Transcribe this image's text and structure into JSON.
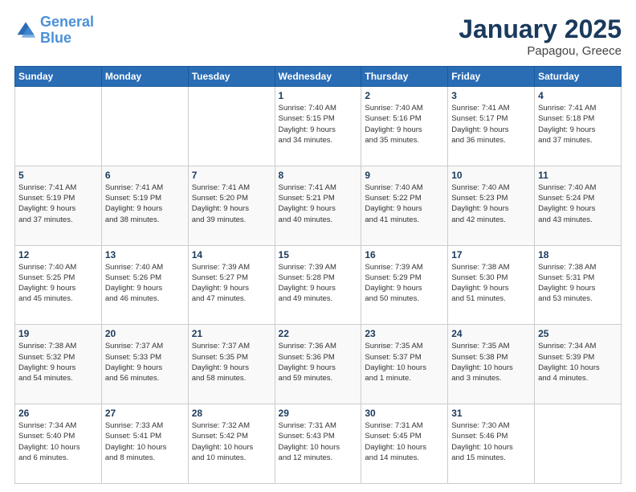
{
  "header": {
    "logo_line1": "General",
    "logo_line2": "Blue",
    "month_title": "January 2025",
    "location": "Papagou, Greece"
  },
  "days_of_week": [
    "Sunday",
    "Monday",
    "Tuesday",
    "Wednesday",
    "Thursday",
    "Friday",
    "Saturday"
  ],
  "weeks": [
    {
      "shaded": false,
      "days": [
        {
          "num": "",
          "info": ""
        },
        {
          "num": "",
          "info": ""
        },
        {
          "num": "",
          "info": ""
        },
        {
          "num": "1",
          "info": "Sunrise: 7:40 AM\nSunset: 5:15 PM\nDaylight: 9 hours\nand 34 minutes."
        },
        {
          "num": "2",
          "info": "Sunrise: 7:40 AM\nSunset: 5:16 PM\nDaylight: 9 hours\nand 35 minutes."
        },
        {
          "num": "3",
          "info": "Sunrise: 7:41 AM\nSunset: 5:17 PM\nDaylight: 9 hours\nand 36 minutes."
        },
        {
          "num": "4",
          "info": "Sunrise: 7:41 AM\nSunset: 5:18 PM\nDaylight: 9 hours\nand 37 minutes."
        }
      ]
    },
    {
      "shaded": true,
      "days": [
        {
          "num": "5",
          "info": "Sunrise: 7:41 AM\nSunset: 5:19 PM\nDaylight: 9 hours\nand 37 minutes."
        },
        {
          "num": "6",
          "info": "Sunrise: 7:41 AM\nSunset: 5:19 PM\nDaylight: 9 hours\nand 38 minutes."
        },
        {
          "num": "7",
          "info": "Sunrise: 7:41 AM\nSunset: 5:20 PM\nDaylight: 9 hours\nand 39 minutes."
        },
        {
          "num": "8",
          "info": "Sunrise: 7:41 AM\nSunset: 5:21 PM\nDaylight: 9 hours\nand 40 minutes."
        },
        {
          "num": "9",
          "info": "Sunrise: 7:40 AM\nSunset: 5:22 PM\nDaylight: 9 hours\nand 41 minutes."
        },
        {
          "num": "10",
          "info": "Sunrise: 7:40 AM\nSunset: 5:23 PM\nDaylight: 9 hours\nand 42 minutes."
        },
        {
          "num": "11",
          "info": "Sunrise: 7:40 AM\nSunset: 5:24 PM\nDaylight: 9 hours\nand 43 minutes."
        }
      ]
    },
    {
      "shaded": false,
      "days": [
        {
          "num": "12",
          "info": "Sunrise: 7:40 AM\nSunset: 5:25 PM\nDaylight: 9 hours\nand 45 minutes."
        },
        {
          "num": "13",
          "info": "Sunrise: 7:40 AM\nSunset: 5:26 PM\nDaylight: 9 hours\nand 46 minutes."
        },
        {
          "num": "14",
          "info": "Sunrise: 7:39 AM\nSunset: 5:27 PM\nDaylight: 9 hours\nand 47 minutes."
        },
        {
          "num": "15",
          "info": "Sunrise: 7:39 AM\nSunset: 5:28 PM\nDaylight: 9 hours\nand 49 minutes."
        },
        {
          "num": "16",
          "info": "Sunrise: 7:39 AM\nSunset: 5:29 PM\nDaylight: 9 hours\nand 50 minutes."
        },
        {
          "num": "17",
          "info": "Sunrise: 7:38 AM\nSunset: 5:30 PM\nDaylight: 9 hours\nand 51 minutes."
        },
        {
          "num": "18",
          "info": "Sunrise: 7:38 AM\nSunset: 5:31 PM\nDaylight: 9 hours\nand 53 minutes."
        }
      ]
    },
    {
      "shaded": true,
      "days": [
        {
          "num": "19",
          "info": "Sunrise: 7:38 AM\nSunset: 5:32 PM\nDaylight: 9 hours\nand 54 minutes."
        },
        {
          "num": "20",
          "info": "Sunrise: 7:37 AM\nSunset: 5:33 PM\nDaylight: 9 hours\nand 56 minutes."
        },
        {
          "num": "21",
          "info": "Sunrise: 7:37 AM\nSunset: 5:35 PM\nDaylight: 9 hours\nand 58 minutes."
        },
        {
          "num": "22",
          "info": "Sunrise: 7:36 AM\nSunset: 5:36 PM\nDaylight: 9 hours\nand 59 minutes."
        },
        {
          "num": "23",
          "info": "Sunrise: 7:35 AM\nSunset: 5:37 PM\nDaylight: 10 hours\nand 1 minute."
        },
        {
          "num": "24",
          "info": "Sunrise: 7:35 AM\nSunset: 5:38 PM\nDaylight: 10 hours\nand 3 minutes."
        },
        {
          "num": "25",
          "info": "Sunrise: 7:34 AM\nSunset: 5:39 PM\nDaylight: 10 hours\nand 4 minutes."
        }
      ]
    },
    {
      "shaded": false,
      "days": [
        {
          "num": "26",
          "info": "Sunrise: 7:34 AM\nSunset: 5:40 PM\nDaylight: 10 hours\nand 6 minutes."
        },
        {
          "num": "27",
          "info": "Sunrise: 7:33 AM\nSunset: 5:41 PM\nDaylight: 10 hours\nand 8 minutes."
        },
        {
          "num": "28",
          "info": "Sunrise: 7:32 AM\nSunset: 5:42 PM\nDaylight: 10 hours\nand 10 minutes."
        },
        {
          "num": "29",
          "info": "Sunrise: 7:31 AM\nSunset: 5:43 PM\nDaylight: 10 hours\nand 12 minutes."
        },
        {
          "num": "30",
          "info": "Sunrise: 7:31 AM\nSunset: 5:45 PM\nDaylight: 10 hours\nand 14 minutes."
        },
        {
          "num": "31",
          "info": "Sunrise: 7:30 AM\nSunset: 5:46 PM\nDaylight: 10 hours\nand 15 minutes."
        },
        {
          "num": "",
          "info": ""
        }
      ]
    }
  ]
}
